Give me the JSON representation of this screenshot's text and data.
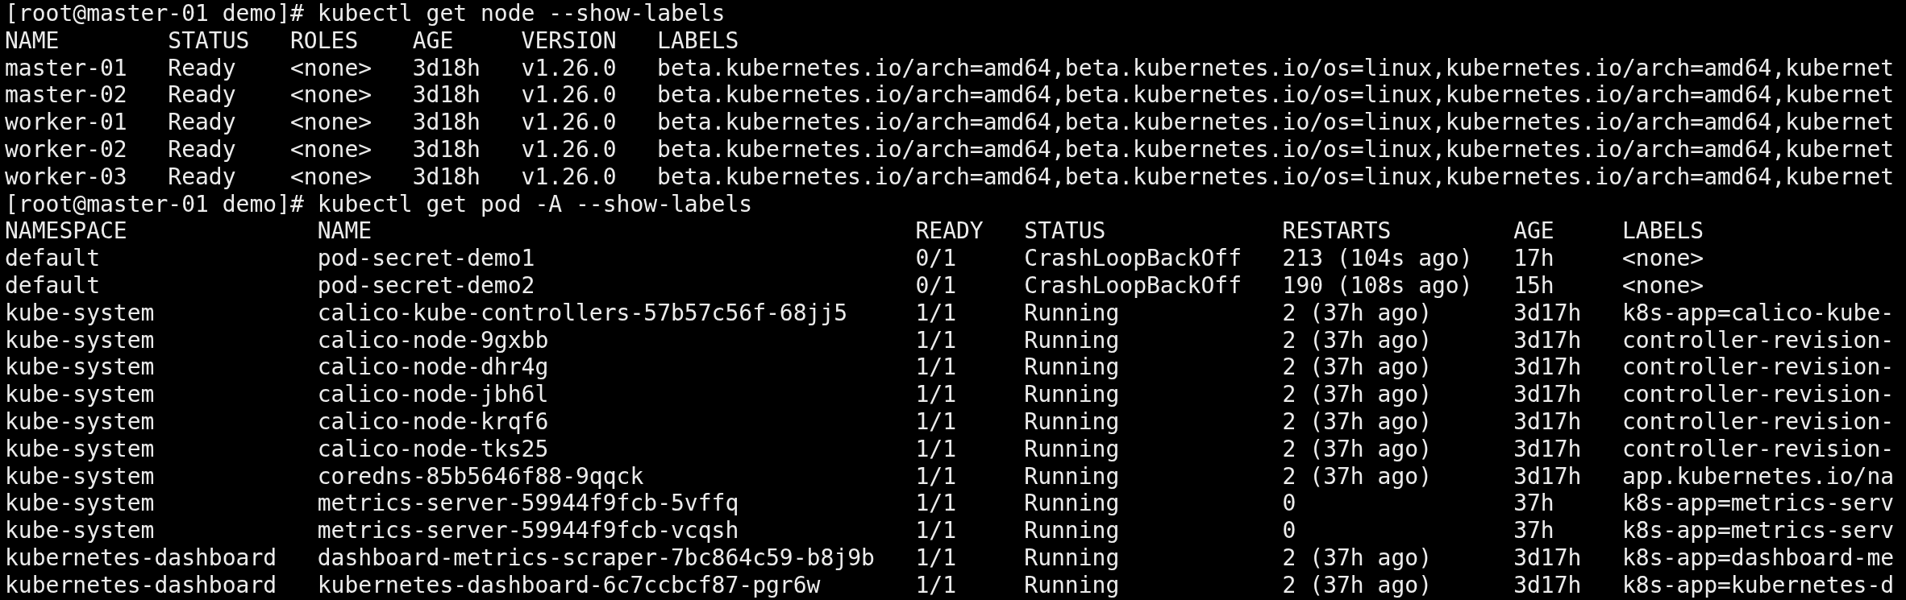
{
  "blocks": [
    {
      "prompt": "[root@master-01 demo]#",
      "command": "kubectl get node --show-labels",
      "table": {
        "columns": [
          "NAME",
          "STATUS",
          "ROLES",
          "AGE",
          "VERSION",
          "LABELS"
        ],
        "rows": [
          [
            "master-01",
            "Ready",
            "<none>",
            "3d18h",
            "v1.26.0",
            "beta.kubernetes.io/arch=amd64,beta.kubernetes.io/os=linux,kubernetes.io/arch=amd64,kubernet"
          ],
          [
            "master-02",
            "Ready",
            "<none>",
            "3d18h",
            "v1.26.0",
            "beta.kubernetes.io/arch=amd64,beta.kubernetes.io/os=linux,kubernetes.io/arch=amd64,kubernet"
          ],
          [
            "worker-01",
            "Ready",
            "<none>",
            "3d18h",
            "v1.26.0",
            "beta.kubernetes.io/arch=amd64,beta.kubernetes.io/os=linux,kubernetes.io/arch=amd64,kubernet"
          ],
          [
            "worker-02",
            "Ready",
            "<none>",
            "3d18h",
            "v1.26.0",
            "beta.kubernetes.io/arch=amd64,beta.kubernetes.io/os=linux,kubernetes.io/arch=amd64,kubernet"
          ],
          [
            "worker-03",
            "Ready",
            "<none>",
            "3d18h",
            "v1.26.0",
            "beta.kubernetes.io/arch=amd64,beta.kubernetes.io/os=linux,kubernetes.io/arch=amd64,kubernet"
          ]
        ]
      }
    },
    {
      "prompt": "[root@master-01 demo]#",
      "command": "kubectl get pod -A --show-labels",
      "table": {
        "columns": [
          "NAMESPACE",
          "NAME",
          "READY",
          "STATUS",
          "RESTARTS",
          "AGE",
          "LABELS"
        ],
        "rows": [
          [
            "default",
            "pod-secret-demo1",
            "0/1",
            "CrashLoopBackOff",
            "213 (104s ago)",
            "17h",
            "<none>"
          ],
          [
            "default",
            "pod-secret-demo2",
            "0/1",
            "CrashLoopBackOff",
            "190 (108s ago)",
            "15h",
            "<none>"
          ],
          [
            "kube-system",
            "calico-kube-controllers-57b57c56f-68jj5",
            "1/1",
            "Running",
            "2 (37h ago)",
            "3d17h",
            "k8s-app=calico-kube-"
          ],
          [
            "kube-system",
            "calico-node-9gxbb",
            "1/1",
            "Running",
            "2 (37h ago)",
            "3d17h",
            "controller-revision-"
          ],
          [
            "kube-system",
            "calico-node-dhr4g",
            "1/1",
            "Running",
            "2 (37h ago)",
            "3d17h",
            "controller-revision-"
          ],
          [
            "kube-system",
            "calico-node-jbh6l",
            "1/1",
            "Running",
            "2 (37h ago)",
            "3d17h",
            "controller-revision-"
          ],
          [
            "kube-system",
            "calico-node-krqf6",
            "1/1",
            "Running",
            "2 (37h ago)",
            "3d17h",
            "controller-revision-"
          ],
          [
            "kube-system",
            "calico-node-tks25",
            "1/1",
            "Running",
            "2 (37h ago)",
            "3d17h",
            "controller-revision-"
          ],
          [
            "kube-system",
            "coredns-85b5646f88-9qqck",
            "1/1",
            "Running",
            "2 (37h ago)",
            "3d17h",
            "app.kubernetes.io/na"
          ],
          [
            "kube-system",
            "metrics-server-59944f9fcb-5vffq",
            "1/1",
            "Running",
            "0",
            "37h",
            "k8s-app=metrics-serv"
          ],
          [
            "kube-system",
            "metrics-server-59944f9fcb-vcqsh",
            "1/1",
            "Running",
            "0",
            "37h",
            "k8s-app=metrics-serv"
          ],
          [
            "kubernetes-dashboard",
            "dashboard-metrics-scraper-7bc864c59-b8j9b",
            "1/1",
            "Running",
            "2 (37h ago)",
            "3d17h",
            "k8s-app=dashboard-me"
          ],
          [
            "kubernetes-dashboard",
            "kubernetes-dashboard-6c7ccbcf87-pgr6w",
            "1/1",
            "Running",
            "2 (37h ago)",
            "3d17h",
            "k8s-app=kubernetes-d"
          ]
        ]
      }
    }
  ]
}
